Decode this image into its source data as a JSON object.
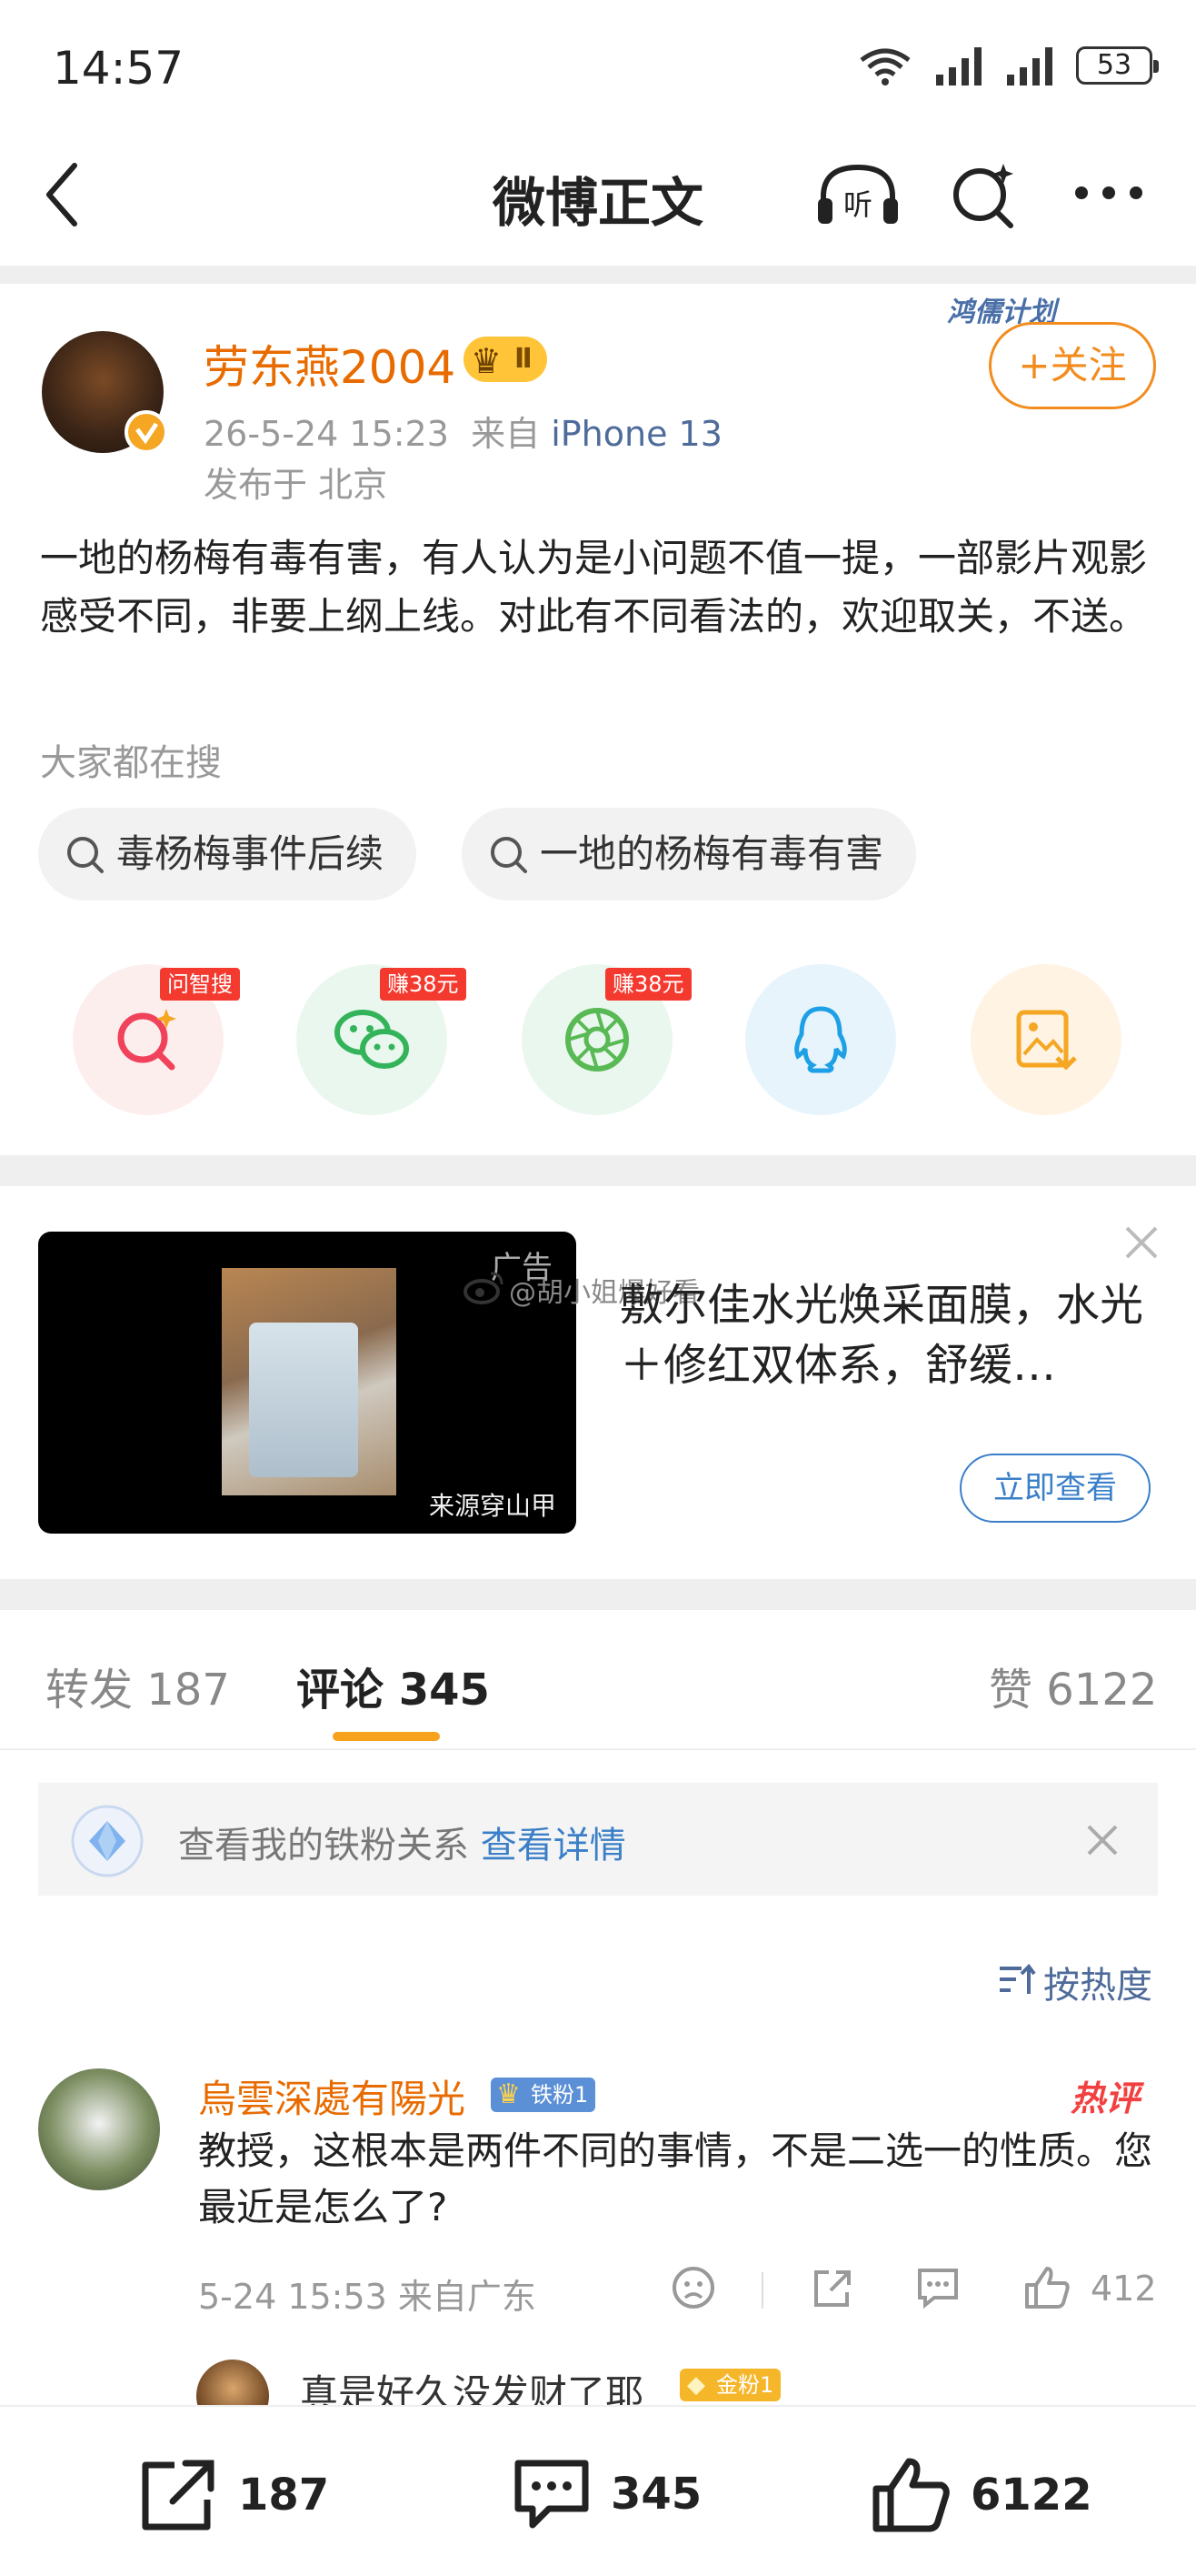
{
  "status_bar": {
    "time": "14:57",
    "battery": "53",
    "network": "5G"
  },
  "nav": {
    "title": "微博正文"
  },
  "post": {
    "author": "劳东燕2004",
    "level": "Ⅱ",
    "date": "26-5-24 15:23",
    "from_label": "来自",
    "device": "iPhone 13",
    "location": "发布于 北京",
    "follow_label": "+关注",
    "plan_label": "鸿儒计划",
    "body": "一地的杨梅有毒有害，有人认为是小问题不值一提，一部影片观影感受不同，非要上纲上线。对此有不同看法的，欢迎取关，不送。"
  },
  "search": {
    "title": "大家都在搜",
    "pills": [
      "毒杨梅事件后续",
      "一地的杨梅有毒有害"
    ]
  },
  "share": {
    "tags": [
      "问智搜",
      "赚38元",
      "赚38元"
    ]
  },
  "ad": {
    "label": "广告",
    "watermark": "@胡小姐爆好看",
    "source": "来源穿山甲",
    "text": "敷尔佳水光焕采面膜，水光＋修红双体系，舒缓…",
    "cta": "立即查看"
  },
  "tabs": {
    "reposts": "转发 187",
    "comments": "评论 345",
    "likes": "赞 6122"
  },
  "fan_banner": {
    "text": "查看我的铁粉关系",
    "link": "查看详情"
  },
  "sort": {
    "label": "按热度"
  },
  "comment": {
    "user": "烏雲深處有陽光",
    "badge": "铁粉1",
    "hot_tag": "热评",
    "text": "教授，这根本是两件不同的事情，不是二选一的性质。您最近是怎么了?",
    "meta": "5-24 15:53  来自广东",
    "likes": "412",
    "reply_text": "真是好久没发财了耶",
    "reply_badge": "金粉1"
  },
  "bottom_bar": {
    "reposts": "187",
    "comments": "345",
    "likes": "6122"
  },
  "colors": {
    "accent_orange": "#f28c1f",
    "link_blue": "#3a7fc8",
    "name_orange": "#e86b00"
  }
}
